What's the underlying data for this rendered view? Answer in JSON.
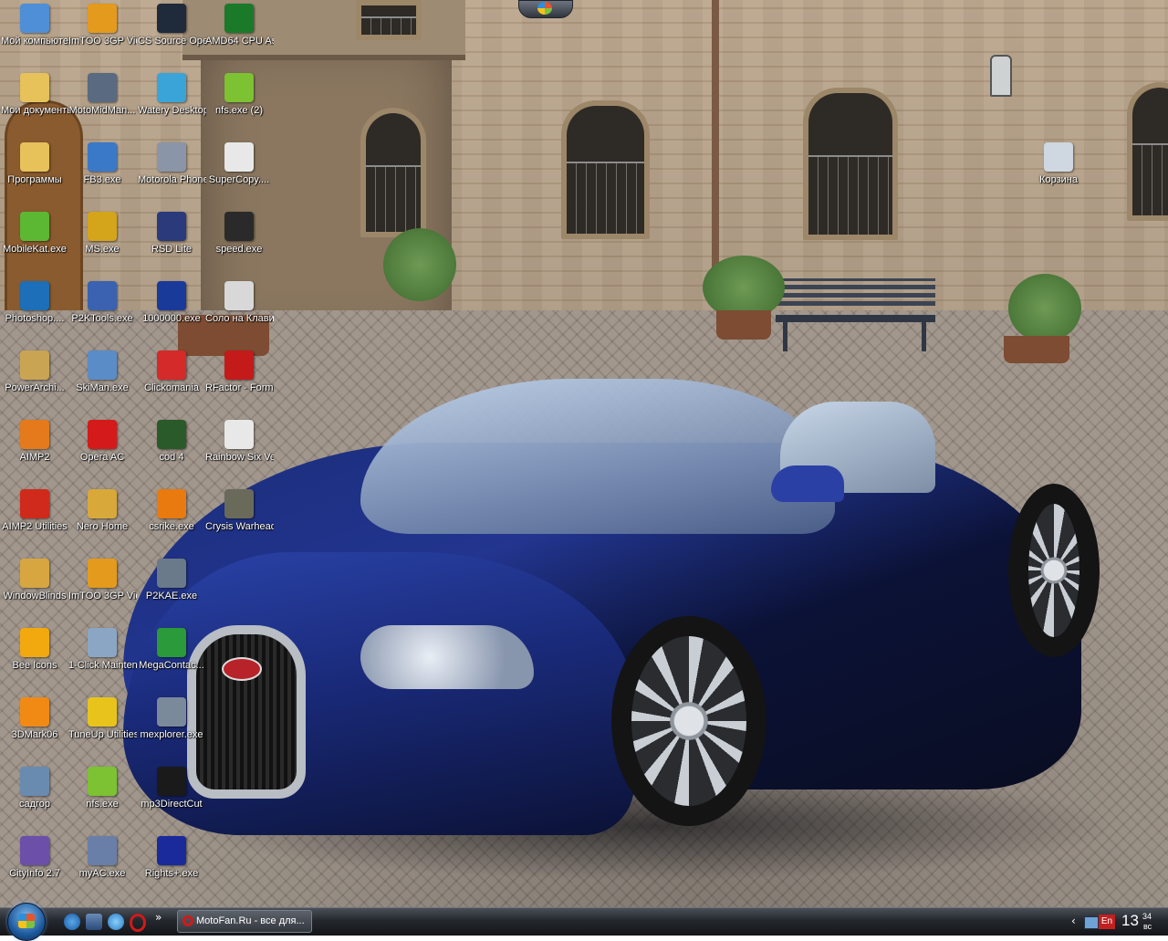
{
  "desktop": {
    "icons": [
      {
        "label": "Мой компьютер",
        "icon": "my-computer-icon",
        "color": "#4f8fd8"
      },
      {
        "label": "Мои документы",
        "icon": "folder-icon",
        "color": "#e7c15a"
      },
      {
        "label": "Программы",
        "icon": "folder-icon",
        "color": "#e7c15a"
      },
      {
        "label": "MobileKat.exe",
        "icon": "cat-app-icon",
        "color": "#5cb832"
      },
      {
        "label": "Photoshop....",
        "icon": "photoshop-icon",
        "color": "#1c6fb8"
      },
      {
        "label": "PowerArchi...",
        "icon": "archiver-icon",
        "color": "#c9a453"
      },
      {
        "label": "AIMP2",
        "icon": "aimp-icon",
        "color": "#e47a1c"
      },
      {
        "label": "AIMP2 Utilities",
        "icon": "aimp-utilities-icon",
        "color": "#d02a1c"
      },
      {
        "label": "WindowBlinds",
        "icon": "palette-icon",
        "color": "#d8a640"
      },
      {
        "label": "Bee Icons",
        "icon": "honeycomb-icon",
        "color": "#f2a80f"
      },
      {
        "label": "3DMark06",
        "icon": "3dmark-icon",
        "color": "#f08a14"
      },
      {
        "label": "садгор",
        "icon": "network-computer-icon",
        "color": "#6a8bb0"
      },
      {
        "label": "CityInfo 2.7",
        "icon": "cityinfo-icon",
        "color": "#6b4fa8"
      },
      {
        "label": "ImTOO 3GP Video Co...",
        "icon": "phone-video-icon",
        "color": "#e49a1c"
      },
      {
        "label": "MotoMidMan...",
        "icon": "gear-icon",
        "color": "#5a6a80"
      },
      {
        "label": "FB3.exe",
        "icon": "fb3-icon",
        "color": "#3a78c8"
      },
      {
        "label": "MS.exe",
        "icon": "ms-icon",
        "color": "#d4a41a"
      },
      {
        "label": "P2KTools.exe",
        "icon": "tools-icon",
        "color": "#3a62b0"
      },
      {
        "label": "SkiMan.exe",
        "icon": "monitor-icon",
        "color": "#5a8cc8"
      },
      {
        "label": "Opera AC",
        "icon": "opera-icon",
        "color": "#d41a1a"
      },
      {
        "label": "Nero Home",
        "icon": "house-icon",
        "color": "#d8a83a"
      },
      {
        "label": "ImTOO 3GP Video Co...",
        "icon": "phone-video-icon",
        "color": "#e49a1c"
      },
      {
        "label": "1-Click Maintenance",
        "icon": "maintenance-icon",
        "color": "#8aa6c4"
      },
      {
        "label": "TuneUp Utilities 2007",
        "icon": "tuneup-icon",
        "color": "#e8c31c"
      },
      {
        "label": "nfs.exe",
        "icon": "nfs-icon",
        "color": "#7cc232"
      },
      {
        "label": "myAC.exe",
        "icon": "shield-icon",
        "color": "#6a7fa8"
      },
      {
        "label": "CS Source Operatio...",
        "icon": "cs-source-icon",
        "color": "#1f2a3a"
      },
      {
        "label": "Watery Desktop 3D",
        "icon": "water-icon",
        "color": "#3aa4d8"
      },
      {
        "label": "Motorola Phone Tools",
        "icon": "phone-icon",
        "color": "#8a96a8"
      },
      {
        "label": "RSD Lite",
        "icon": "motorola-icon",
        "color": "#2a3a7a"
      },
      {
        "label": "1000000.exe",
        "icon": "coins-icon",
        "color": "#1a3a9a"
      },
      {
        "label": "Clickomania",
        "icon": "blocks-icon",
        "color": "#d42a2a"
      },
      {
        "label": "cod 4",
        "icon": "cod-icon",
        "color": "#2a5a2a"
      },
      {
        "label": "csrike.exe",
        "icon": "half-life-icon",
        "color": "#e87a10"
      },
      {
        "label": "P2KAE.exe",
        "icon": "phone-icon",
        "color": "#6a7a8a"
      },
      {
        "label": "MegaContac...",
        "icon": "contacts-icon",
        "color": "#2a9a3a"
      },
      {
        "label": "mexplorer.exe",
        "icon": "phone-icon",
        "color": "#7a8a9a"
      },
      {
        "label": "mp3DirectCut",
        "icon": "mp3-cut-icon",
        "color": "#1a1a1a"
      },
      {
        "label": "Rights+.exe",
        "icon": "rights-icon",
        "color": "#1a2a9a"
      },
      {
        "label": "AMD64 CPU Assistant",
        "icon": "amd-icon",
        "color": "#1a7a2a"
      },
      {
        "label": "nfs.exe (2)",
        "icon": "nfs-icon",
        "color": "#7cc232"
      },
      {
        "label": "SuperCopy....",
        "icon": "binary-icon",
        "color": "#e8e8e8"
      },
      {
        "label": "speed.exe",
        "icon": "nfs-mw-icon",
        "color": "#2a2a2a"
      },
      {
        "label": "Соло на Клавиату...",
        "icon": "keyboard-icon",
        "color": "#d8d8d8"
      },
      {
        "label": "RFactor - Formula ...",
        "icon": "rfactor-icon",
        "color": "#c41a1a"
      },
      {
        "label": "Rainbow Six Vegas II",
        "icon": "vegas-icon",
        "color": "#e8e8e8"
      },
      {
        "label": "Crysis Warhead",
        "icon": "soldier-icon",
        "color": "#6a6a5a"
      },
      {
        "label": "Корзина",
        "icon": "recycle-bin-icon",
        "color": "#cfd8e0"
      }
    ]
  },
  "taskbar": {
    "task_button_label": "MotoFan.Ru - все для...",
    "language": "En",
    "clock_hour": "13",
    "clock_minute": "34",
    "clock_day": "вс"
  }
}
